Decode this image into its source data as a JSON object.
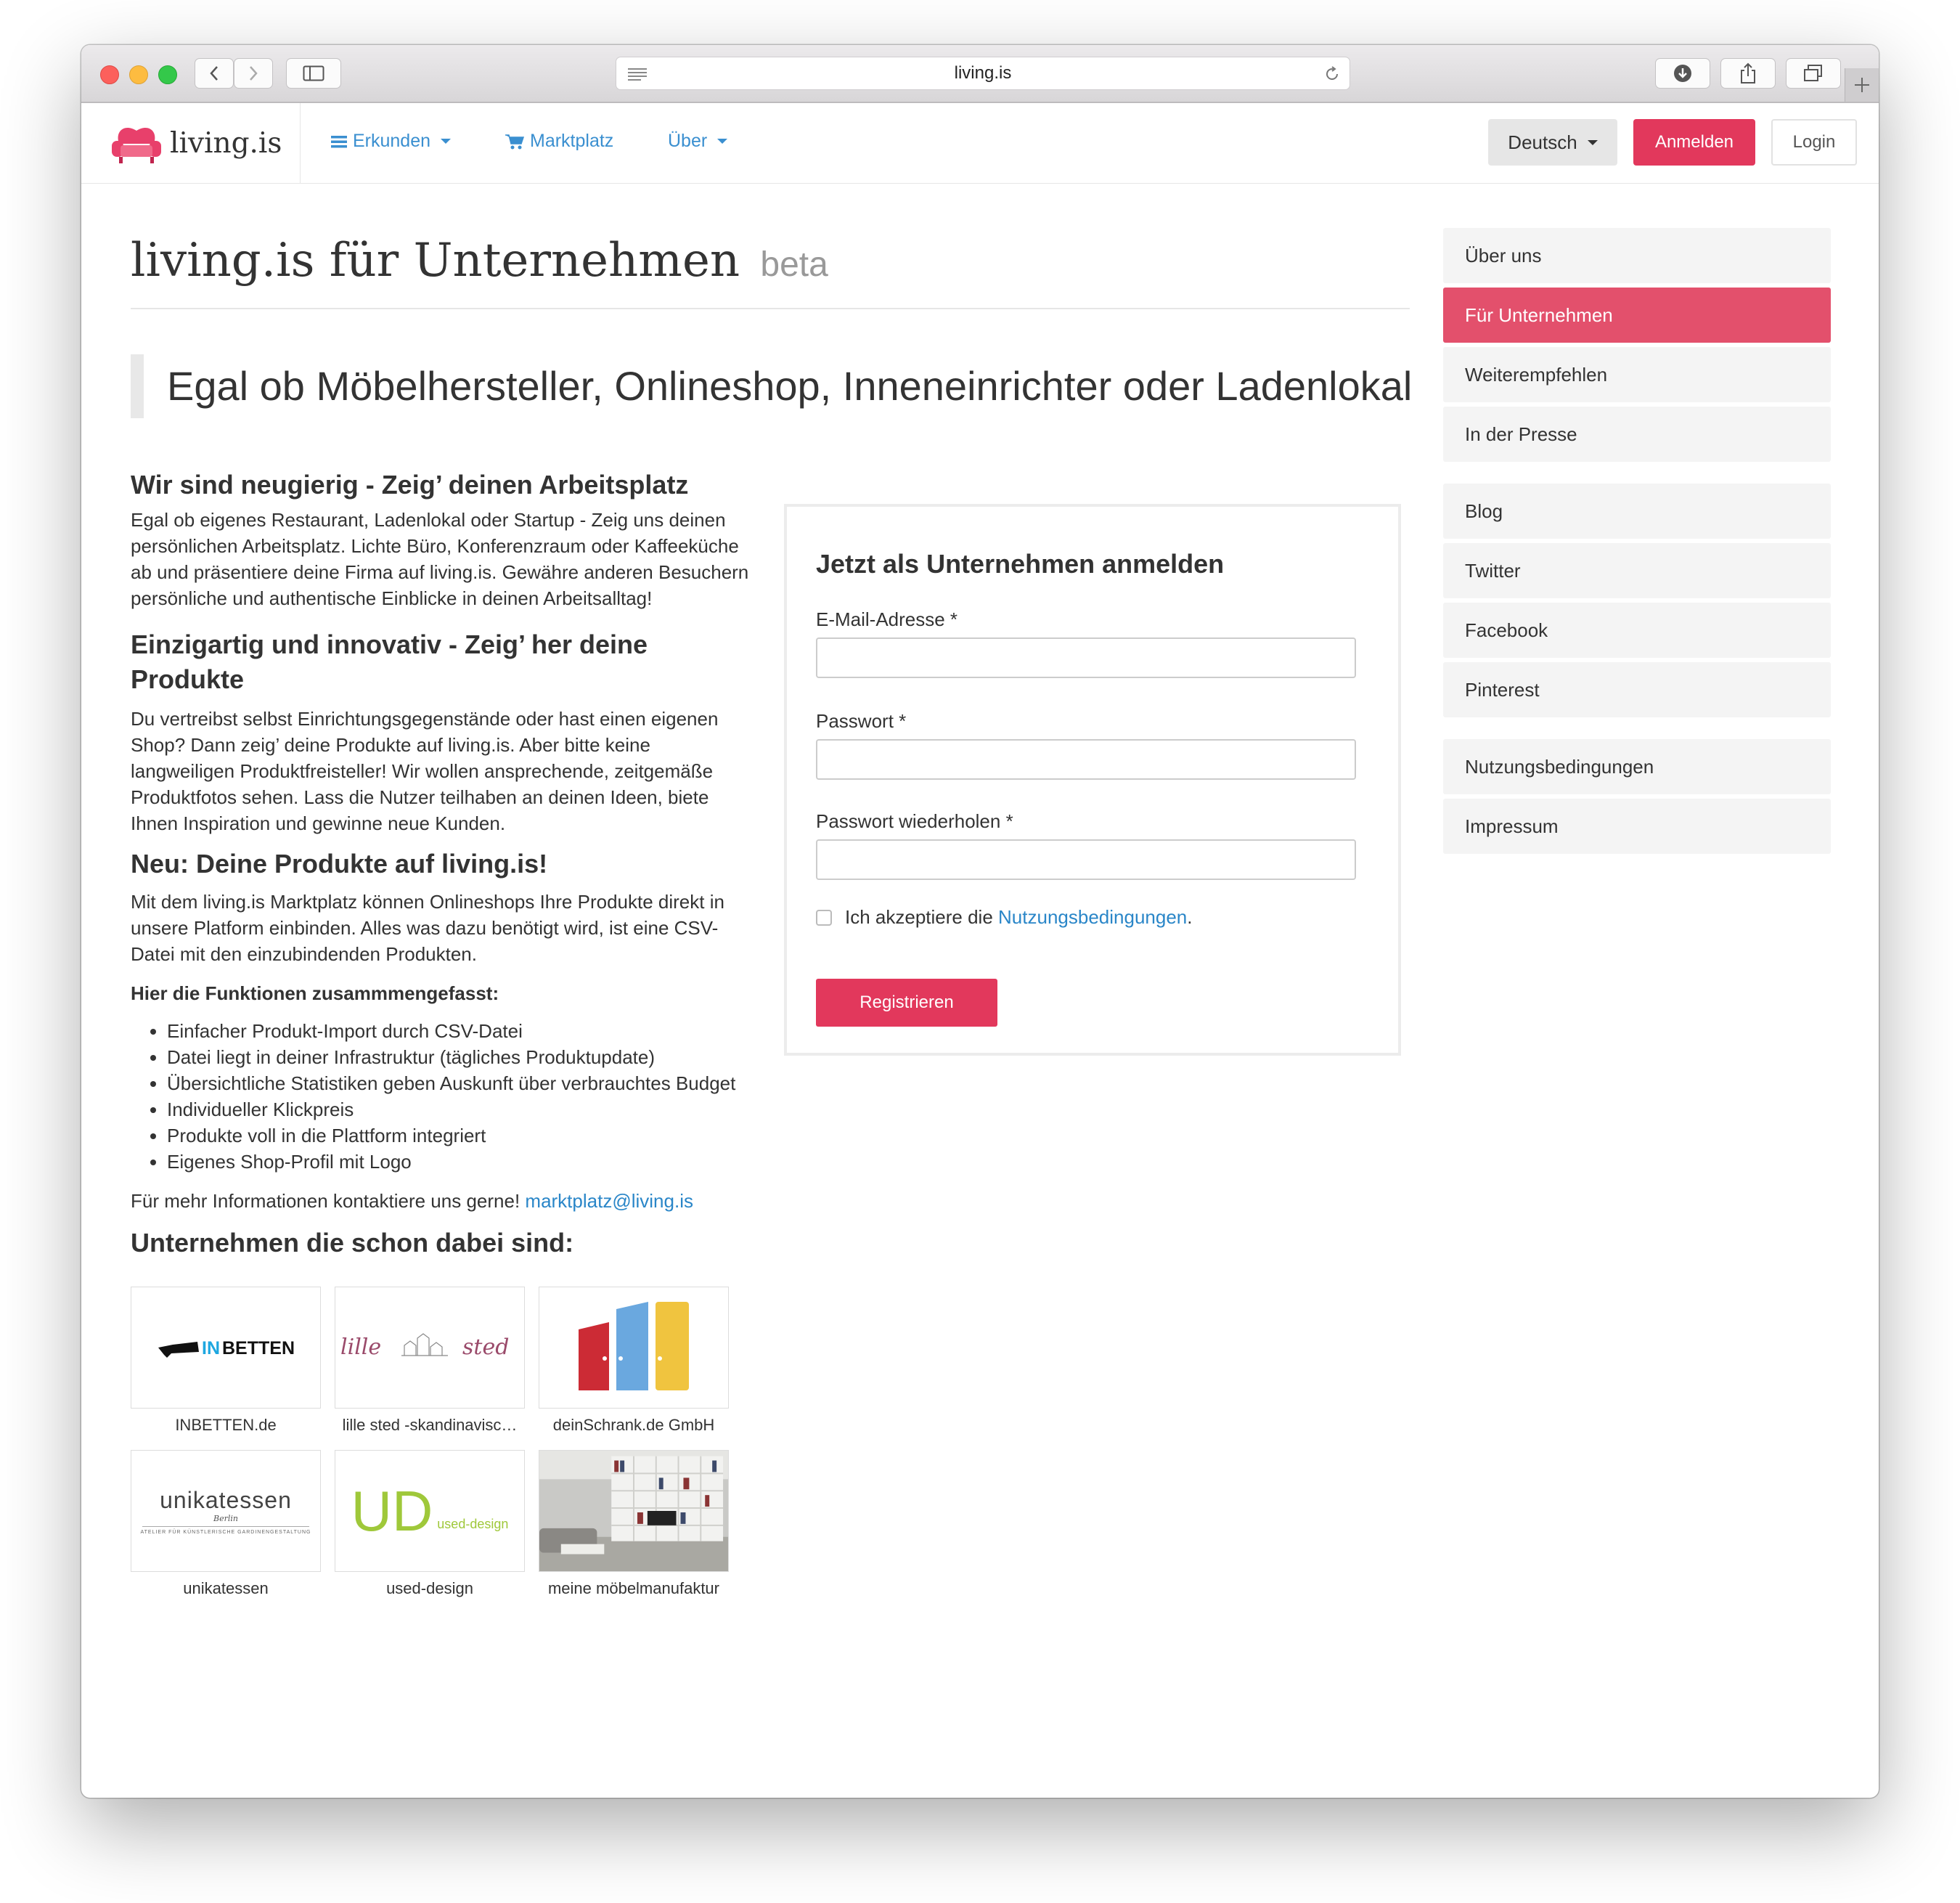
{
  "browser": {
    "url": "living.is"
  },
  "navbar": {
    "brand": "living.is",
    "links": [
      {
        "label": "Erkunden",
        "icon": "list-icon",
        "dropdown": true
      },
      {
        "label": "Marktplatz",
        "icon": "cart-icon",
        "dropdown": false
      },
      {
        "label": "Über",
        "dropdown": true
      }
    ],
    "language": "Deutsch",
    "signup": "Anmelden",
    "login": "Login",
    "accent_color": "#e2385c",
    "link_color": "#3a8fd0"
  },
  "page": {
    "title": "living.is für Unternehmen",
    "title_badge": "beta",
    "lead": "Egal ob Möbelhersteller, Onlineshop, Inneneinrichter oder Ladenlokal"
  },
  "sections": {
    "s1_title": "Wir sind neugierig - Zeig’ deinen Arbeitsplatz",
    "s1_text": "Egal ob eigenes Restaurant, Ladenlokal oder Startup - Zeig uns deinen persönlichen Arbeitsplatz. Lichte Büro, Konferenzraum oder Kaffeeküche ab und präsentiere deine Firma auf living.is. Gewähre anderen Besuchern persönliche und authentische Einblicke in deinen Arbeitsalltag!",
    "s2_title": "Einzigartig und innovativ - Zeig’ her deine Produkte",
    "s2_text": "Du vertreibst selbst Einrichtungsgegenstände oder hast einen eigenen Shop? Dann zeig’ deine Produkte auf living.is. Aber bitte keine langweiligen Produktfreisteller! Wir wollen ansprechende, zeitgemäße Produktfotos sehen. Lass die Nutzer teilhaben an deinen Ideen, biete Ihnen Inspiration und gewinne neue Kunden.",
    "s3_title": "Neu: Deine Produkte auf living.is!",
    "s3_text": "Mit dem living.is Marktplatz können Onlineshops Ihre Produkte direkt in unsere Platform einbinden. Alles was dazu benötigt wird, ist eine CSV-Datei mit den einzubindenden Produkten.",
    "features_title": "Hier die Funktionen zusammmengefasst:",
    "features": [
      "Einfacher Produkt-Import durch CSV-Datei",
      "Datei liegt in deiner Infrastruktur (tägliches Produktupdate)",
      "Übersichtliche Statistiken geben Auskunft über verbrauchtes Budget",
      "Individueller Klickpreis",
      "Produkte voll in die Plattform integriert",
      "Eigenes Shop-Profil mit Logo"
    ],
    "contact_text": "Für mehr Informationen kontaktiere uns gerne!",
    "contact_email": "marktplatz@living.is",
    "companies_title": "Unternehmen die schon dabei sind:"
  },
  "companies": [
    {
      "name": "INBETTEN.de",
      "logo_text": "INBETTEN",
      "logo_accent": "IN"
    },
    {
      "name": "lille sted -skandinavisc…",
      "logo_text": "lille sted"
    },
    {
      "name": "deinSchrank.de GmbH"
    },
    {
      "name": "unikatessen",
      "logo_text": "unikatessen",
      "logo_sub": "Berlin",
      "logo_tag": "ATELIER FÜR KÜNSTLERISCHE GARDINENGESTALTUNG"
    },
    {
      "name": "used-design",
      "logo_text": "UD",
      "logo_sub": "used-design"
    },
    {
      "name": "meine möbelmanufaktur"
    }
  ],
  "form": {
    "title": "Jetzt als Unternehmen anmelden",
    "email_label": "E-Mail-Adresse *",
    "email_value": "",
    "password_label": "Passwort *",
    "password_value": "",
    "password_repeat_label": "Passwort wiederholen *",
    "password_repeat_value": "",
    "terms_prefix": "Ich akzeptiere die",
    "terms_link": "Nutzungsbedingungen",
    "terms_suffix": ".",
    "terms_checked": false,
    "submit": "Registrieren"
  },
  "sidebar": {
    "groups": [
      [
        {
          "label": "Über uns"
        },
        {
          "label": "Für Unternehmen",
          "active": true
        },
        {
          "label": "Weiterempfehlen"
        },
        {
          "label": "In der Presse"
        }
      ],
      [
        {
          "label": "Blog"
        },
        {
          "label": "Twitter"
        },
        {
          "label": "Facebook"
        },
        {
          "label": "Pinterest"
        }
      ],
      [
        {
          "label": "Nutzungsbedingungen"
        },
        {
          "label": "Impressum"
        }
      ]
    ]
  }
}
